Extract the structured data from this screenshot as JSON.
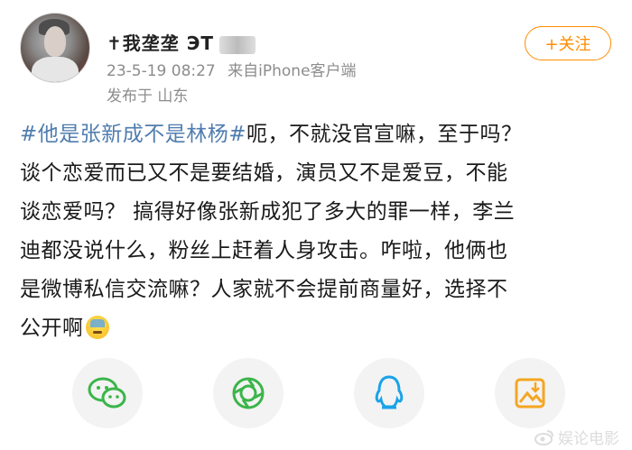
{
  "post": {
    "username": "✝我垄垄 ЭТ",
    "timestamp": "23-5-19 08:27",
    "source": "来自iPhone客户端",
    "location": "发布于 山东",
    "follow_label": "+关注",
    "hashtag": "#他是张新成不是林杨#",
    "lines": [
      "呃，不就没官宣嘛，至于吗？",
      "谈个恋爱而已又不是要结婚，演员又不是爱豆，不能",
      "谈恋爱吗？ 搞得好像张新成犯了多大的罪一样，李兰",
      "迪都没说什么，粉丝上赶着人身攻击。咋啦，他俩也",
      "是微博私信交流嘛？人家就不会提前商量好，选择不",
      "公开啊"
    ],
    "emoji": "sweat-emoji"
  },
  "share_bar": {
    "icons": [
      "wechat-icon",
      "moments-icon",
      "qq-icon",
      "save-image-icon"
    ],
    "colors": {
      "wechat": "#3bb54a",
      "moments": "#3bb54a",
      "qq": "#1aa3e8",
      "save": "#f5a623"
    }
  },
  "watermark": {
    "text": "娱论电影"
  },
  "colors": {
    "hashtag": "#507daf",
    "follow": "#ff8c00",
    "meta": "#8c8c8c"
  }
}
